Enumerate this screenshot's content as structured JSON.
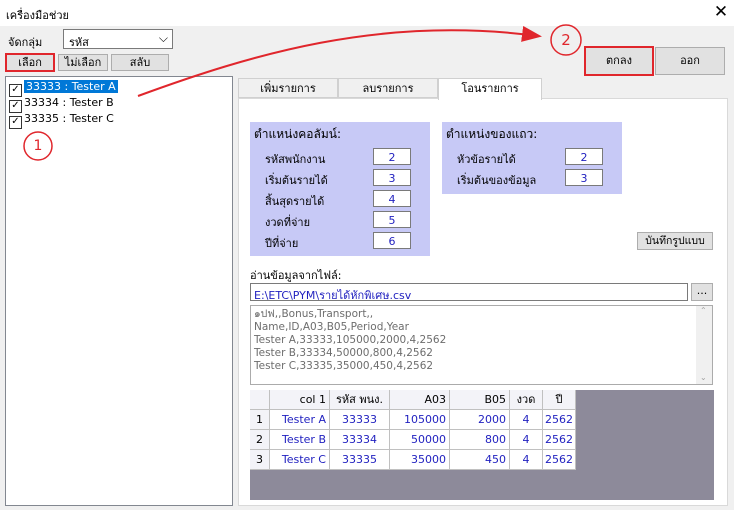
{
  "window": {
    "title": "เครื่องมือช่วย",
    "close": "✕"
  },
  "group": {
    "label": "จัดกลุ่ม",
    "value": "รหัส"
  },
  "buttons": {
    "select": "เลือก",
    "deselect": "ไม่เลือก",
    "toggle": "สลับ",
    "ok": "ตกลง",
    "exit": "ออก"
  },
  "tree": [
    {
      "label": "33333 : Tester   A",
      "checked": true,
      "selected": true
    },
    {
      "label": "33334 : Tester   B",
      "checked": true,
      "selected": false
    },
    {
      "label": "33335 : Tester   C",
      "checked": true,
      "selected": false
    }
  ],
  "tabs": [
    "เพิ่มรายการ",
    "ลบรายการ",
    "โอนรายการ"
  ],
  "column_position": {
    "title": "ตำแหน่งคอลัมน์:",
    "rows": [
      {
        "label": "รหัสพนักงาน",
        "value": "2"
      },
      {
        "label": "เริ่มต้นรายได้",
        "value": "3"
      },
      {
        "label": "สิ้นสุดรายได้",
        "value": "4"
      },
      {
        "label": "งวดที่จ่าย",
        "value": "5"
      },
      {
        "label": "ปีที่จ่าย",
        "value": "6"
      }
    ]
  },
  "row_position": {
    "title": "ตำแหน่งของแถว:",
    "rows": [
      {
        "label": "หัวข้อรายได้",
        "value": "2"
      },
      {
        "label": "เริ่มต้นของข้อมูล",
        "value": "3"
      }
    ]
  },
  "save_format": "บันทึกรูปแบบ",
  "file": {
    "label": "อ่านข้อมูลจากไฟล์:",
    "path": "E:\\ETC\\PYM\\รายได้หักพิเศษ.csv",
    "browse": "..."
  },
  "preview_lines": [
    "๑ปฟ,,Bonus,Transport,,",
    "Name,ID,A03,B05,Period,Year",
    "Tester A,33333,105000,2000,4,2562",
    "Tester B,33334,50000,800,4,2562",
    "Tester C,33335,35000,450,4,2562"
  ],
  "grid": {
    "headers": [
      "col 1",
      "รหัส พนง.",
      "A03",
      "B05",
      "งวด",
      "ปี"
    ],
    "rows": [
      {
        "num": "1",
        "cells": [
          "Tester A",
          "33333",
          "105000",
          "2000",
          "4",
          "2562"
        ]
      },
      {
        "num": "2",
        "cells": [
          "Tester B",
          "33334",
          "50000",
          "800",
          "4",
          "2562"
        ]
      },
      {
        "num": "3",
        "cells": [
          "Tester C",
          "33335",
          "35000",
          "450",
          "4",
          "2562"
        ]
      }
    ]
  },
  "annotations": {
    "step1": "1",
    "step2": "2",
    "accent_color": "#e0262c"
  }
}
